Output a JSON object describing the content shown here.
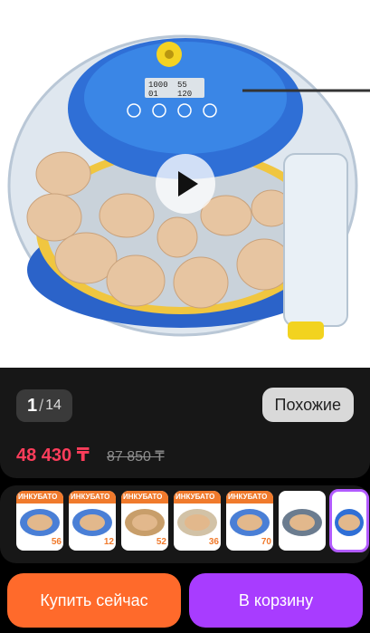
{
  "product": {
    "image_alt": "",
    "device_display": {
      "top": "1000",
      "top_right": "55",
      "bottom_left": "01",
      "bottom_right": "120"
    }
  },
  "gallery": {
    "current": "1",
    "separator": "/",
    "total": "14"
  },
  "similar_button": "Похожие",
  "pricing": {
    "price": "48 430 ₸",
    "old_price": "87 850 ₸"
  },
  "thumbnails": [
    {
      "label": "ИНКУБАТО",
      "badge": "56"
    },
    {
      "label": "ИНКУБАТО",
      "badge": "12"
    },
    {
      "label": "ИНКУБАТО",
      "badge": "52"
    },
    {
      "label": "ИНКУБАТО",
      "badge": "36"
    },
    {
      "label": "ИНКУБАТО",
      "badge": "70"
    },
    {
      "label": "",
      "badge": ""
    },
    {
      "label": "",
      "badge": ""
    }
  ],
  "actions": {
    "buy_now": "Купить сейчас",
    "add_to_cart": "В корзину"
  },
  "colors": {
    "accent_price": "#ff3d5b",
    "buy": "#ff6a2b",
    "cart": "#a83cff",
    "active_thumb": "#b25bff"
  }
}
